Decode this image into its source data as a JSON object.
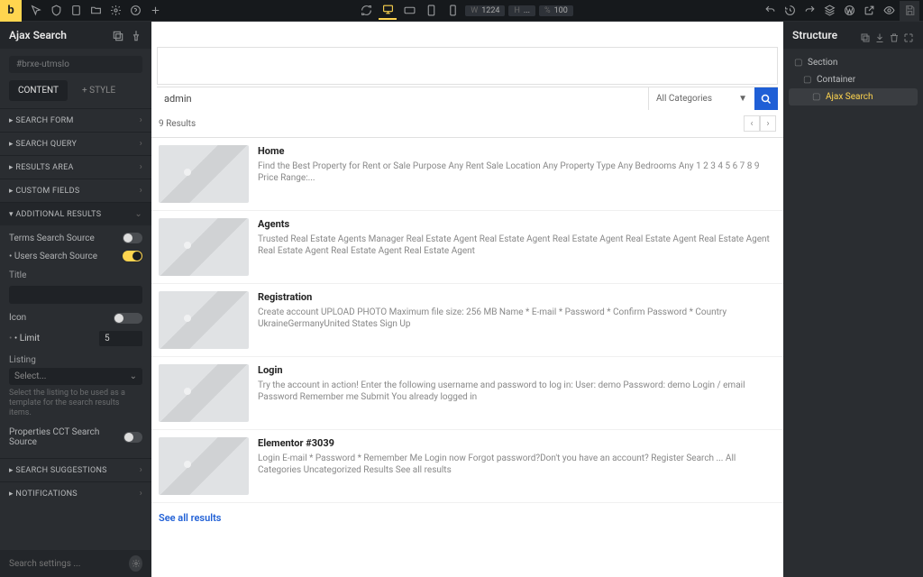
{
  "topbar": {
    "logo": "b",
    "width_label": "W",
    "width_value": "1224",
    "height_label": "H",
    "height_value": "...",
    "zoom_label": "%",
    "zoom_value": "100"
  },
  "left": {
    "title": "Ajax Search",
    "id_chip": "#brxe-utmslo",
    "tabs": {
      "content": "CONTENT",
      "style": "+ STYLE"
    },
    "sections": {
      "search_form": "SEARCH FORM",
      "search_query": "SEARCH QUERY",
      "results_area": "RESULTS AREA",
      "custom_fields": "CUSTOM FIELDS",
      "additional_results": "ADDITIONAL RESULTS",
      "search_suggestions": "SEARCH SUGGESTIONS",
      "notifications": "NOTIFICATIONS"
    },
    "additional": {
      "terms_label": "Terms Search Source",
      "users_label": "Users Search Source",
      "title_label": "Title",
      "title_value": "",
      "icon_label": "Icon",
      "limit_label": "Limit",
      "limit_value": "5",
      "listing_label": "Listing",
      "listing_select": "Select...",
      "listing_help": "Select the listing to be used as a template for the search results items.",
      "cct_label": "Properties CCT Search Source"
    },
    "footer_placeholder": "Search settings ..."
  },
  "canvas": {
    "search_value": "admin",
    "category_label": "All Categories",
    "results_count": "9 Results",
    "see_all": "See all results",
    "results": [
      {
        "title": "Home",
        "desc": "Find the Best Property for Rent or Sale Purpose Any Rent Sale Location Any Property Type Any Bedrooms Any 1 2 3 4 5 6 7 8 9 Price Range:..."
      },
      {
        "title": "Agents",
        "desc": "Trusted Real Estate Agents Manager Real Estate Agent Real Estate Agent Real Estate Agent Real Estate Agent Real Estate Agent Real Estate Agent Real Estate Agent Real Estate Agent"
      },
      {
        "title": "Registration",
        "desc": "Create account UPLOAD PHOTO Maximum file size: 256 MB Name * E-mail * Password * Confirm Password * Country UkraineGermanyUnited States Sign Up"
      },
      {
        "title": "Login",
        "desc": "Try the account in action! Enter the following username and password to log in: User: demo Password: demo Login / email Password Remember me Submit You already logged in"
      },
      {
        "title": "Elementor #3039",
        "desc": "Login E-mail * Password * Remember Me Login now Forgot password?Don't you have an account? Register Search ... All Categories Uncategorized Results See all results"
      }
    ]
  },
  "right": {
    "title": "Structure",
    "items": [
      {
        "label": "Section",
        "lvl": 0
      },
      {
        "label": "Container",
        "lvl": 1
      },
      {
        "label": "Ajax Search",
        "lvl": 2,
        "sel": true
      }
    ]
  }
}
